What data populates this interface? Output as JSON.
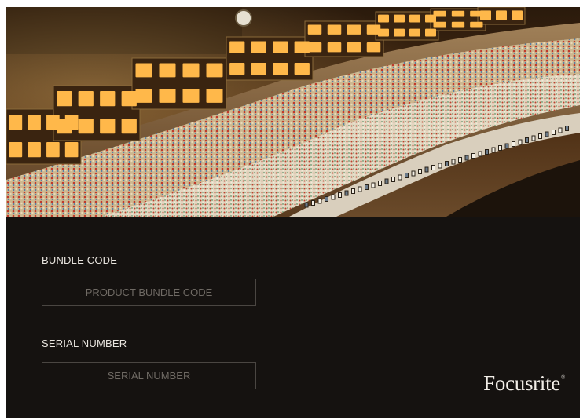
{
  "bundle_code": {
    "label": "BUNDLE CODE",
    "placeholder": "PRODUCT BUNDLE CODE",
    "value": ""
  },
  "serial_number": {
    "label": "SERIAL NUMBER",
    "placeholder": "SERIAL NUMBER",
    "value": ""
  },
  "brand": {
    "name": "Focusrite",
    "mark": "®"
  },
  "colors": {
    "panel_background": "#151210",
    "label_text": "#e8e4de",
    "placeholder_text": "#6f6a64",
    "field_border": "#4a4642"
  }
}
